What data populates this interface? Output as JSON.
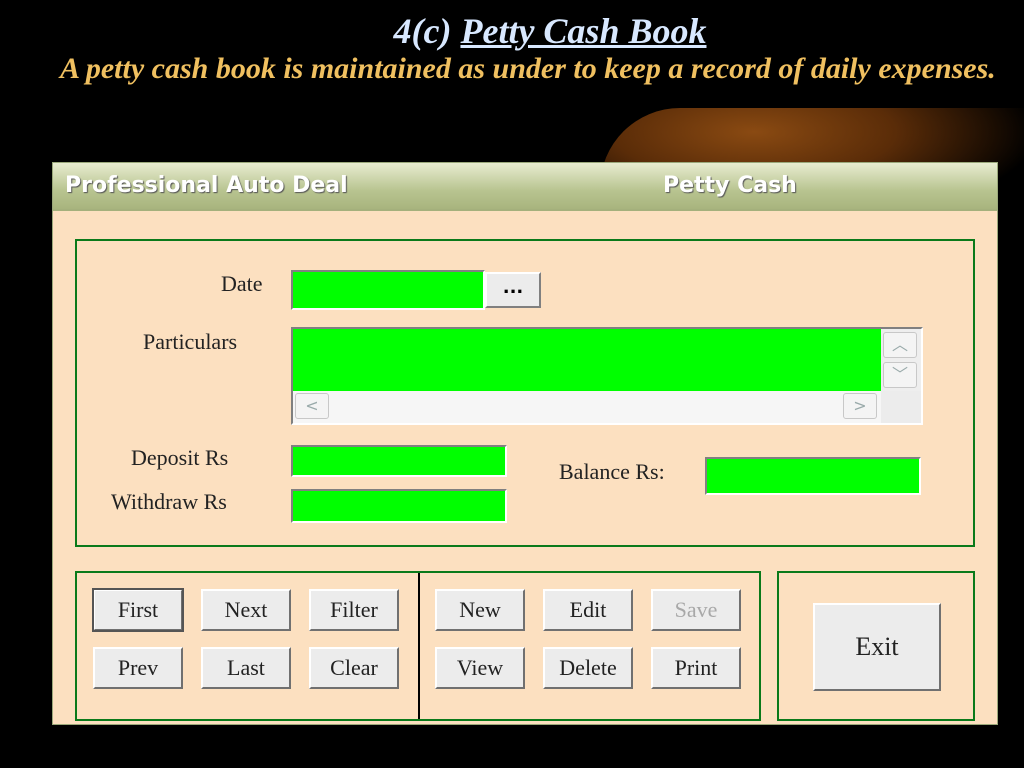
{
  "slide": {
    "title_prefix": "4(c) ",
    "title_main": "Petty Cash Book",
    "intro": "A petty cash book is maintained as under to keep a record of daily expenses."
  },
  "window": {
    "company": "Professional Auto Deal",
    "form_title": "Petty Cash"
  },
  "fields": {
    "date_label": "Date",
    "date_value": "",
    "date_button": "...",
    "particulars_label": "Particulars",
    "particulars_value": "",
    "deposit_label": "Deposit Rs",
    "deposit_value": "",
    "withdraw_label": "Withdraw Rs",
    "withdraw_value": "",
    "balance_label": "Balance Rs:",
    "balance_value": ""
  },
  "nav_buttons": {
    "first": "First",
    "next": "Next",
    "filter": "Filter",
    "prev": "Prev",
    "last": "Last",
    "clear": "Clear"
  },
  "action_buttons": {
    "new": "New",
    "edit": "Edit",
    "save": "Save",
    "view": "View",
    "delete": "Delete",
    "print": "Print"
  },
  "exit_button": "Exit",
  "colors": {
    "field_green": "#00ff00",
    "panel_border": "#0a7a1a",
    "window_bg": "#fce0c0"
  }
}
